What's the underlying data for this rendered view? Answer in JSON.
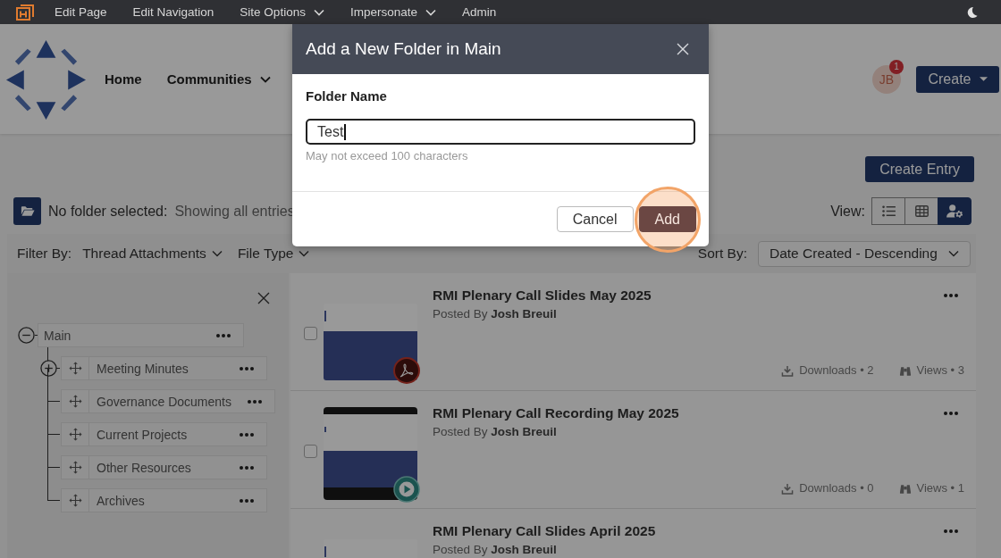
{
  "top_bar": {
    "items": [
      {
        "label": "Edit Page",
        "dropdown": false
      },
      {
        "label": "Edit Navigation",
        "dropdown": false
      },
      {
        "label": "Site Options",
        "dropdown": true
      },
      {
        "label": "Impersonate",
        "dropdown": true
      },
      {
        "label": "Admin",
        "dropdown": false
      }
    ]
  },
  "header": {
    "nav": [
      {
        "label": "Home",
        "dropdown": false
      },
      {
        "label": "Communities",
        "dropdown": true
      }
    ],
    "avatar": {
      "initials": "JB",
      "badge": "1"
    },
    "create_button": {
      "label": "Create"
    }
  },
  "toolbar": {
    "create_entry": "Create Entry",
    "folder_label": "No folder selected:",
    "folder_value": "Showing all entries",
    "view_label": "View:",
    "views": [
      {
        "kind": "list",
        "selected": false
      },
      {
        "kind": "grid",
        "selected": false
      },
      {
        "kind": "user-settings",
        "selected": true
      }
    ]
  },
  "filters": {
    "label": "Filter By:",
    "options": [
      {
        "label": "Thread Attachments"
      },
      {
        "label": "File Type"
      }
    ],
    "sort_label": "Sort By:",
    "sort_value": "Date Created - Descending"
  },
  "folder_tree": {
    "root": {
      "label": "Main",
      "expanded": true,
      "children": [
        {
          "label": "Meeting Minutes",
          "expanded": false
        },
        {
          "label": "Governance Documents"
        },
        {
          "label": "Current Projects"
        },
        {
          "label": "Other Resources"
        },
        {
          "label": "Archives"
        }
      ]
    }
  },
  "entries": [
    {
      "title": "RMI Plenary Call Slides May 2025",
      "posted_by": "Posted By **Josh Breuil**",
      "kind": "pdf",
      "checked": false,
      "downloads": "Downloads • 2",
      "views": "Views • 3"
    },
    {
      "title": "RMI Plenary Call Recording May 2025",
      "posted_by": "Posted By **Josh Breuil**",
      "kind": "video",
      "checked": false,
      "downloads": "Downloads • 0",
      "views": "Views • 1"
    },
    {
      "title": "RMI Plenary Call Slides April 2025",
      "posted_by": "Posted By **Josh Breuil**"
    }
  ],
  "modal": {
    "title": "Add a New Folder in Main",
    "field_label": "Folder Name",
    "value": "Test",
    "hint": "May not exceed 100 characters",
    "buttons": [
      {
        "label": "Cancel",
        "kind": "secondary",
        "highlighted": false
      },
      {
        "label": "Add",
        "kind": "primary",
        "highlighted": true
      }
    ]
  }
}
